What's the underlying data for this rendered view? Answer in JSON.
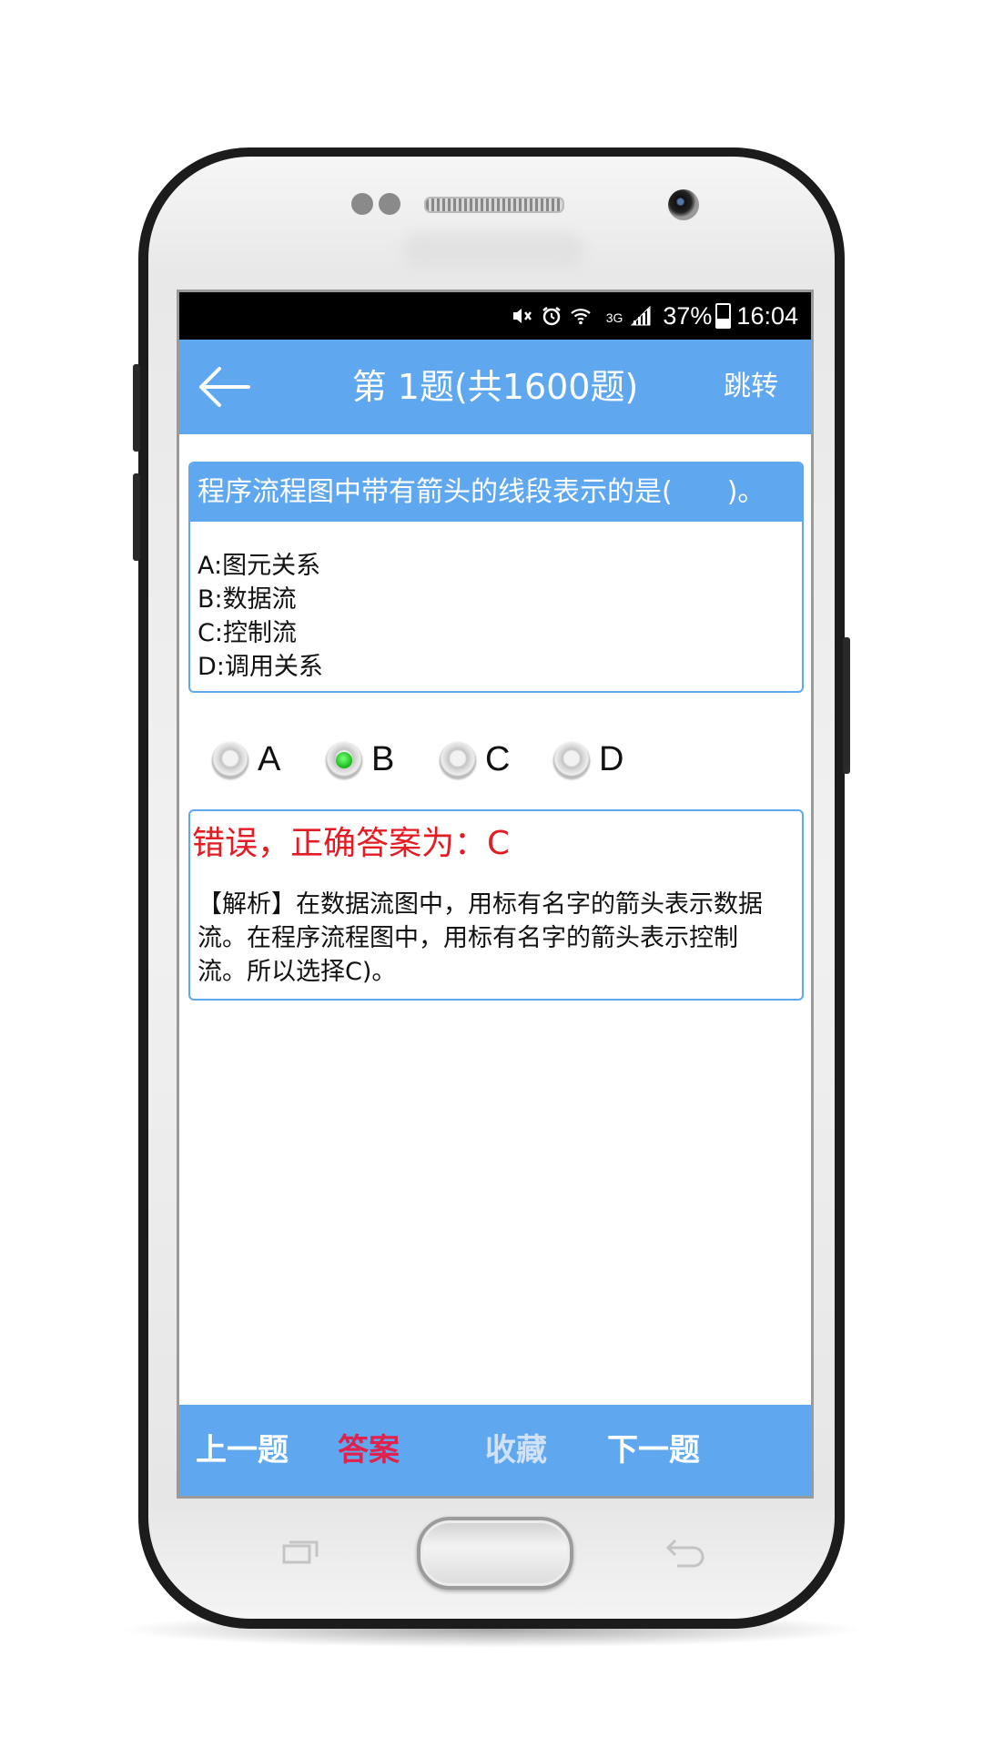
{
  "status_bar": {
    "battery": "37%",
    "time": "16:04",
    "network": "3G",
    "icons": [
      "mute-icon",
      "alarm-icon",
      "wifi-icon",
      "signal-icon",
      "battery-icon"
    ]
  },
  "app_bar": {
    "back_icon": "arrow-left-icon",
    "title": "第 1题(共1600题)",
    "jump_label": "跳转"
  },
  "question": {
    "text": "程序流程图中带有箭头的线段表示的是(　　)。",
    "options": [
      "A:图元关系",
      "B:数据流",
      "C:控制流",
      "D:调用关系"
    ]
  },
  "choices": {
    "items": [
      "A",
      "B",
      "C",
      "D"
    ],
    "selected": "B"
  },
  "result": {
    "text": "错误，正确答案为：C",
    "analysis": "【解析】在数据流图中，用标有名字的箭头表示数据流。在程序流程图中，用标有名字的箭头表示控制流。所以选择C)。"
  },
  "bottom_nav": {
    "prev_label": "上一题",
    "answer_label": "答案",
    "favorite_label": "收藏",
    "next_label": "下一题"
  },
  "colors": {
    "primary": "#5fa8f0",
    "error": "#e31b23",
    "answer_active": "#e0234e",
    "favorite_muted": "#cfe2f7",
    "selected_radio": "#14b814"
  }
}
